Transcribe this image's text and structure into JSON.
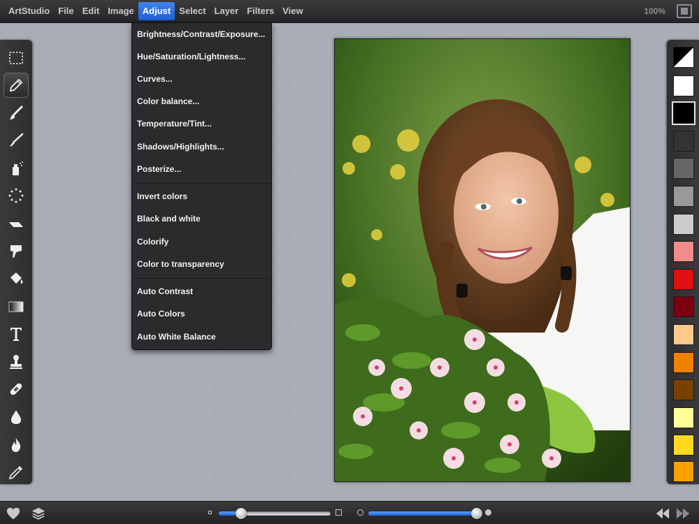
{
  "menubar": {
    "app_name": "ArtStudio",
    "items": [
      "File",
      "Edit",
      "Image",
      "Adjust",
      "Select",
      "Layer",
      "Filters",
      "View"
    ],
    "active_item": "Adjust",
    "zoom": "100%"
  },
  "adjust_menu": {
    "group1": [
      "Brightness/Contrast/Exposure...",
      "Hue/Saturation/Lightness...",
      "Curves...",
      "Color balance...",
      "Temperature/Tint...",
      "Shadows/Highlights...",
      "Posterize..."
    ],
    "group2": [
      "Invert colors",
      "Black and white",
      "Colorify",
      "Color to transparency"
    ],
    "group3": [
      "Auto Contrast",
      "Auto Colors",
      "Auto White Balance"
    ]
  },
  "tools": [
    {
      "name": "rectangle-select-icon",
      "selected": false
    },
    {
      "name": "pencil-icon",
      "selected": true
    },
    {
      "name": "brush-icon",
      "selected": false
    },
    {
      "name": "paintbrush-icon",
      "selected": false
    },
    {
      "name": "spray-can-icon",
      "selected": false
    },
    {
      "name": "scatter-icon",
      "selected": false
    },
    {
      "name": "eraser-icon",
      "selected": false
    },
    {
      "name": "smudge-icon",
      "selected": false
    },
    {
      "name": "paint-bucket-icon",
      "selected": false
    },
    {
      "name": "gradient-icon",
      "selected": false
    },
    {
      "name": "text-icon",
      "selected": false
    },
    {
      "name": "stamp-icon",
      "selected": false
    },
    {
      "name": "bandage-icon",
      "selected": false
    },
    {
      "name": "blur-drop-icon",
      "selected": false
    },
    {
      "name": "burn-icon",
      "selected": false
    },
    {
      "name": "eyedropper-icon",
      "selected": false
    }
  ],
  "swatches": [
    "split-black-white",
    "#ffffff",
    "#000000",
    "#333333",
    "#666666",
    "#999999",
    "#cccccc",
    "#f28b8b",
    "#e01010",
    "#7a0010",
    "#ffc98a",
    "#f08000",
    "#7a4000",
    "#ffff99",
    "#ffd820",
    "#ffa000"
  ],
  "bottombar": {
    "left_icons": [
      "heart-icon",
      "layers-icon"
    ],
    "size_slider_value": 0.2,
    "opacity_slider_value": 0.97,
    "right_icons": [
      "undo-icon",
      "redo-icon"
    ]
  }
}
